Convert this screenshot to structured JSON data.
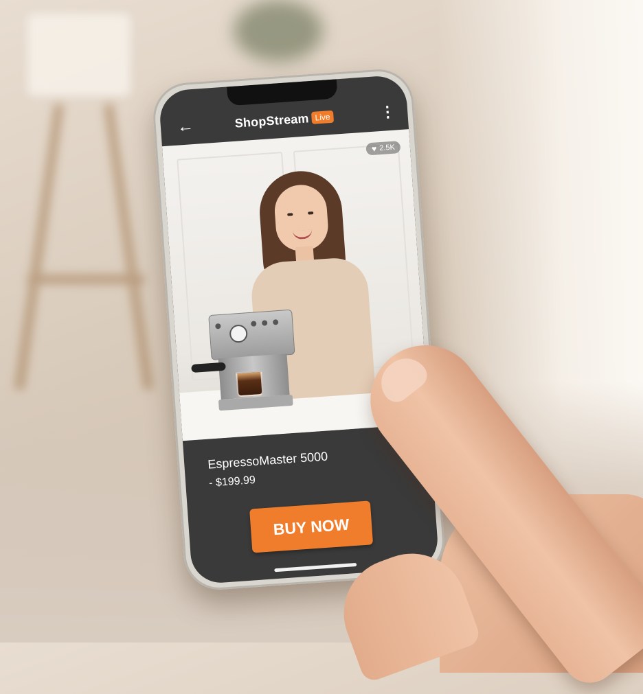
{
  "app": {
    "title": "ShopStream",
    "live_label": "Live",
    "back_icon": "arrow-left-icon",
    "menu_icon": "more-vertical-icon"
  },
  "stream": {
    "likes": "2.5K",
    "likes_icon": "heart-icon",
    "corner_icon": "pour-icon"
  },
  "product": {
    "name": "EspressoMaster 5000",
    "price": "- $199.99"
  },
  "cta": {
    "buy_label": "BUY NOW"
  },
  "colors": {
    "accent": "#f07d2c",
    "screen_bg": "#3a3a3a",
    "text": "#ffffff"
  }
}
